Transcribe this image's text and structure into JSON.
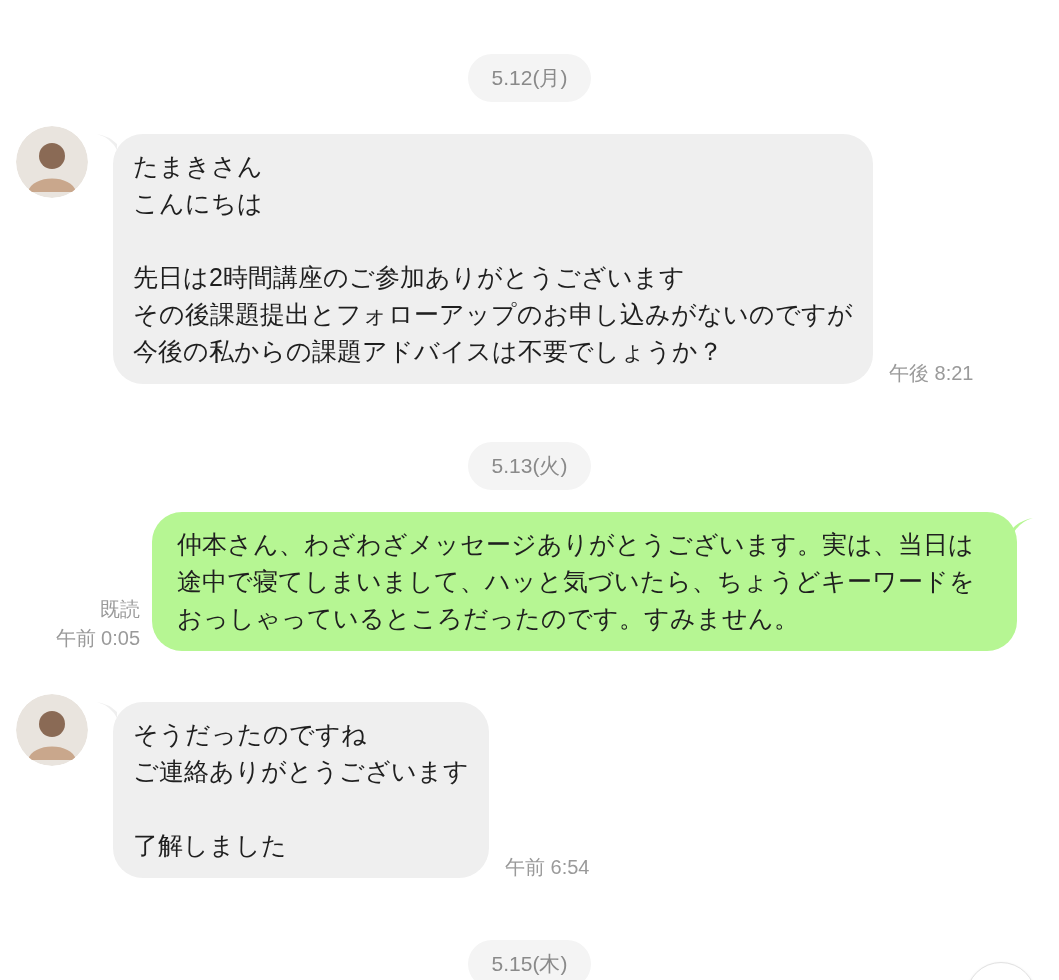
{
  "messages": [
    {
      "kind": "date",
      "text": "5.12(月)"
    },
    {
      "kind": "incoming",
      "paragraphs": [
        [
          "たまきさん",
          "こんにちは"
        ],
        [
          "先日は2時間講座のご参加ありがとうございます",
          "その後課題提出とフォローアップのお申し込みがないのですが",
          "今後の私からの課題アドバイスは不要でしょうか？"
        ]
      ],
      "time": "午後 8:21"
    },
    {
      "kind": "date",
      "text": "5.13(火)"
    },
    {
      "kind": "outgoing",
      "text": "仲本さん、わざわざメッセージありがとうございます。実は、当日は途中で寝てしまいまして、ハッと気づいたら、ちょうどキーワードをおっしゃっているところだったのです。すみません。",
      "read": "既読",
      "time": "午前 0:05"
    },
    {
      "kind": "incoming",
      "paragraphs": [
        [
          "そうだったのですね",
          "ご連絡ありがとうございます"
        ],
        [
          "了解しました"
        ]
      ],
      "time": "午前 6:54"
    },
    {
      "kind": "date",
      "text": "5.15(木)"
    }
  ]
}
